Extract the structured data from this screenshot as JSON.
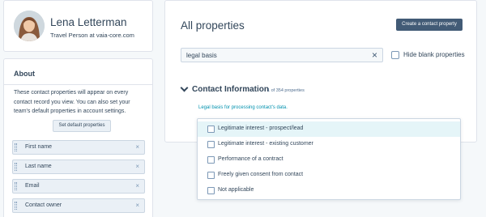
{
  "profile": {
    "name": "Lena Letterman",
    "subtitle": "Travel Person at vaia-core.com"
  },
  "about": {
    "title": "About",
    "description": "These contact properties will appear on every contact record you view. You can also set your team's default properties in account settings.",
    "default_button": "Set default properties",
    "items": [
      {
        "label": "First name"
      },
      {
        "label": "Last name"
      },
      {
        "label": "Email"
      },
      {
        "label": "Contact owner"
      }
    ]
  },
  "main": {
    "title": "All properties",
    "create_button": "Create a contact property",
    "search_value": "legal basis",
    "hide_blank_label": "Hide blank properties",
    "section_title": "Contact Information",
    "section_count": "1 of 354 properties",
    "field_label": "Legal basis for processing contact's data."
  },
  "dropdown": {
    "options": [
      {
        "label": "Legitimate interest - prospect/lead",
        "highlighted": true
      },
      {
        "label": "Legitimate interest - existing customer",
        "highlighted": false
      },
      {
        "label": "Performance of a contract",
        "highlighted": false
      },
      {
        "label": "Freely given consent from contact",
        "highlighted": false
      },
      {
        "label": "Not applicable",
        "highlighted": false
      }
    ]
  },
  "icons": {
    "clear": "close-icon",
    "section_toggle": "chevron-down-icon",
    "remove_property": "close-icon"
  },
  "colors": {
    "primary_button": "#425b76",
    "link": "#0091ae",
    "highlight": "#e5f5f8"
  }
}
